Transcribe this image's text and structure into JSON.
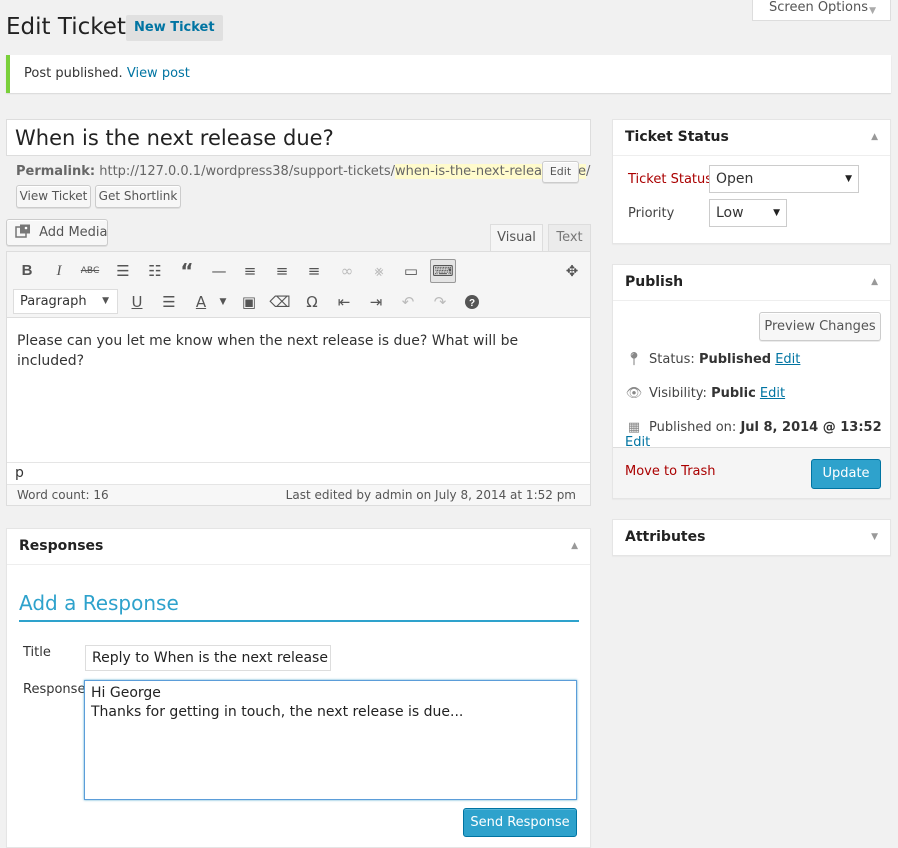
{
  "header": {
    "screen_options": "Screen Options",
    "page_title": "Edit Ticket",
    "new_ticket": "New Ticket"
  },
  "notice": {
    "text": "Post published.",
    "link": "View post"
  },
  "post": {
    "title": "When is the next release due?",
    "permalink_label": "Permalink:",
    "permalink_base": "http://127.0.0.1/wordpress38/support-tickets/",
    "permalink_slug": "when-is-the-next-release-due",
    "permalink_end": "/",
    "edit_slug": "Edit",
    "view_ticket": "View Ticket",
    "get_shortlink": "Get Shortlink"
  },
  "editor": {
    "add_media": "Add Media",
    "tab_visual": "Visual",
    "tab_text": "Text",
    "format": "Paragraph",
    "content": "Please can you let me know when the next release is due? What will be included?",
    "path": "p",
    "word_count": "Word count: 16",
    "last_edited": "Last edited by admin on July 8, 2014 at 1:52 pm"
  },
  "responses": {
    "heading": "Responses",
    "add_heading": "Add a Response",
    "title_label": "Title",
    "title_value": "Reply to When is the next release",
    "response_label": "Response",
    "response_value": "Hi George\nThanks for getting in touch, the next release is due...",
    "send": "Send Response"
  },
  "ticket_status": {
    "heading": "Ticket Status",
    "status_label": "Ticket Status",
    "status_value": "Open",
    "priority_label": "Priority",
    "priority_value": "Low"
  },
  "publish": {
    "heading": "Publish",
    "preview": "Preview Changes",
    "status_label": "Status:",
    "status_value": "Published",
    "visibility_label": "Visibility:",
    "visibility_value": "Public",
    "published_label": "Published on:",
    "published_value": "Jul 8, 2014 @ 13:52",
    "edit": "Edit",
    "trash": "Move to Trash",
    "update": "Update"
  },
  "attributes": {
    "heading": "Attributes"
  },
  "colors": {
    "accent": "#2ea2cc",
    "link": "#0074a2",
    "danger": "#a00",
    "notice": "#7ad03a"
  }
}
